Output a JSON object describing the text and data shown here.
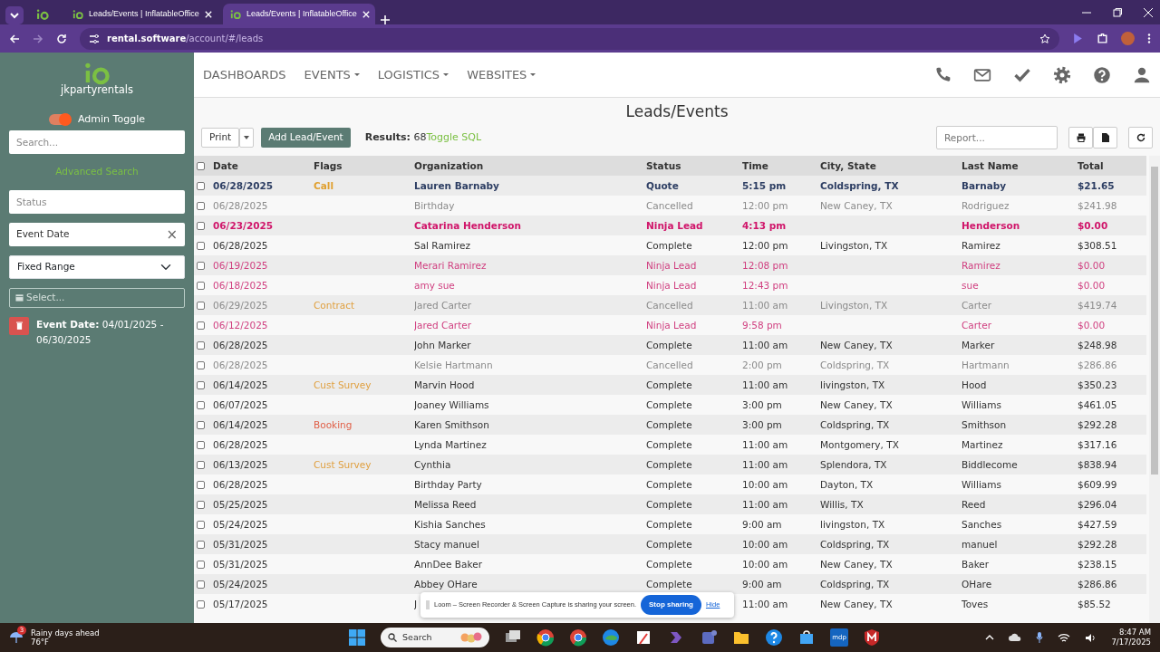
{
  "browser": {
    "tabs": [
      {
        "title": "Leads/Events | InflatableOffice",
        "selected": false
      },
      {
        "title": "Leads/Events | InflatableOffice",
        "selected": true
      }
    ],
    "url": {
      "host": "rental.software",
      "path": "/account/#/leads"
    }
  },
  "sidebar": {
    "brand": "jkpartyrentals",
    "admin_toggle": {
      "label": "Admin Toggle",
      "on": true
    },
    "search": {
      "placeholder": "Search..."
    },
    "advanced_search": "Advanced Search",
    "status": {
      "placeholder": "Status"
    },
    "event_date": {
      "value": "Event Date",
      "clear": "×"
    },
    "range": {
      "value": "Fixed Range"
    },
    "date_picker": {
      "placeholder": "Select..."
    },
    "filter": "**Event Date:** 04/01/2025 - 06/30/2025"
  },
  "nav": [
    {
      "label": "DASHBOARDS",
      "dropdown": false
    },
    {
      "label": "EVENTS",
      "dropdown": true
    },
    {
      "label": "LOGISTICS",
      "dropdown": true
    },
    {
      "label": "WEBSITES",
      "dropdown": true
    }
  ],
  "page": {
    "title": "Leads/Events",
    "print": "Print",
    "add": "Add Lead/Event",
    "results": "**Results:** 68",
    "toggle_sql": "Toggle SQL",
    "report": {
      "placeholder": "Report..."
    }
  },
  "table": {
    "columns": [
      "Date",
      "Flags",
      "Organization",
      "Status",
      "Time",
      "City, State",
      "Last Name",
      "Total"
    ],
    "all_checked": false,
    "rows": [
      {
        "kind": "quote",
        "checked": false,
        "date": "06/28/2025",
        "flag": {
          "text": "Call",
          "color": "#e0a030"
        },
        "org": "Lauren Barnaby",
        "status": "Quote",
        "time": "5:15 pm",
        "city": "Coldspring, TX",
        "last": "Barnaby",
        "total": "$21.65"
      },
      {
        "kind": "cancelled",
        "checked": false,
        "date": "06/28/2025",
        "org": "Birthday",
        "status": "Cancelled",
        "time": "12:00 pm",
        "city": "New Caney, TX",
        "last": "Rodriguez",
        "total": "$241.98"
      },
      {
        "kind": "ninja_new",
        "checked": false,
        "date": "06/23/2025",
        "org": "Catarina Henderson",
        "status": "Ninja Lead",
        "time": "4:13 pm",
        "last": "Henderson",
        "total": "$0.00"
      },
      {
        "kind": "complete",
        "checked": false,
        "date": "06/28/2025",
        "org": "Sal Ramirez",
        "status": "Complete",
        "time": "12:00 pm",
        "city": "Livingston, TX",
        "last": "Ramirez",
        "total": "$308.51"
      },
      {
        "kind": "ninja",
        "checked": false,
        "date": "06/19/2025",
        "org": "Merari Ramirez",
        "status": "Ninja Lead",
        "time": "12:08 pm",
        "last": "Ramirez",
        "total": "$0.00"
      },
      {
        "kind": "ninja",
        "checked": false,
        "date": "06/18/2025",
        "org": "amy sue",
        "status": "Ninja Lead",
        "time": "12:43 pm",
        "last": "sue",
        "total": "$0.00"
      },
      {
        "kind": "cancelled",
        "checked": false,
        "date": "06/29/2025",
        "flag": {
          "text": "Contract",
          "color": "#e0a040"
        },
        "org": "Jared Carter",
        "status": "Cancelled",
        "time": "11:00 am",
        "city": "Livingston, TX",
        "last": "Carter",
        "total": "$419.74"
      },
      {
        "kind": "ninja",
        "checked": false,
        "date": "06/12/2025",
        "org": "Jared Carter",
        "status": "Ninja Lead",
        "time": "9:58 pm",
        "last": "Carter",
        "total": "$0.00"
      },
      {
        "kind": "complete",
        "checked": false,
        "date": "06/28/2025",
        "org": "John Marker",
        "status": "Complete",
        "time": "11:00 am",
        "city": "New Caney, TX",
        "last": "Marker",
        "total": "$248.98"
      },
      {
        "kind": "cancelled",
        "checked": false,
        "date": "06/28/2025",
        "org": "Kelsie Hartmann",
        "status": "Cancelled",
        "time": "2:00 pm",
        "city": "Coldspring, TX",
        "last": "Hartmann",
        "total": "$286.86"
      },
      {
        "kind": "complete",
        "checked": false,
        "date": "06/14/2025",
        "flag": {
          "text": "Cust Survey",
          "color": "#e0a040"
        },
        "org": "Marvin Hood",
        "status": "Complete",
        "time": "11:00 am",
        "city": "livingston, TX",
        "last": "Hood",
        "total": "$350.23"
      },
      {
        "kind": "complete",
        "checked": false,
        "date": "06/07/2025",
        "org": "Joaney Williams",
        "status": "Complete",
        "time": "3:00 pm",
        "city": "New Caney, TX",
        "last": "Williams",
        "total": "$461.05"
      },
      {
        "kind": "complete",
        "checked": false,
        "date": "06/14/2025",
        "flag": {
          "text": "Booking",
          "color": "#e06048"
        },
        "org": "Karen Smithson",
        "status": "Complete",
        "time": "3:00 pm",
        "city": "Coldspring, TX",
        "last": "Smithson",
        "total": "$292.28"
      },
      {
        "kind": "complete",
        "checked": false,
        "date": "06/28/2025",
        "org": "Lynda Martinez",
        "status": "Complete",
        "time": "11:00 am",
        "city": "Montgomery, TX",
        "last": "Martinez",
        "total": "$317.16"
      },
      {
        "kind": "complete",
        "checked": false,
        "date": "06/13/2025",
        "flag": {
          "text": "Cust Survey",
          "color": "#e0a040"
        },
        "org": "Cynthia",
        "status": "Complete",
        "time": "11:00 am",
        "city": "Splendora, TX",
        "last": "Biddlecome",
        "total": "$838.94"
      },
      {
        "kind": "complete",
        "checked": false,
        "date": "06/28/2025",
        "org": "Birthday Party",
        "status": "Complete",
        "time": "10:00 am",
        "city": "Dayton, TX",
        "last": "Williams",
        "total": "$609.99"
      },
      {
        "kind": "complete",
        "checked": false,
        "date": "05/25/2025",
        "org": "Melissa Reed",
        "status": "Complete",
        "time": "11:00 am",
        "city": "Willis, TX",
        "last": "Reed",
        "total": "$296.04"
      },
      {
        "kind": "complete",
        "checked": false,
        "date": "05/24/2025",
        "org": "Kishia Sanches",
        "status": "Complete",
        "time": "9:00 am",
        "city": "livingston, TX",
        "last": "Sanches",
        "total": "$427.59"
      },
      {
        "kind": "complete",
        "checked": false,
        "date": "05/31/2025",
        "org": "Stacy manuel",
        "status": "Complete",
        "time": "10:00 am",
        "city": "Coldspring, TX",
        "last": "manuel",
        "total": "$292.28"
      },
      {
        "kind": "complete",
        "checked": false,
        "date": "05/31/2025",
        "org": "AnnDee Baker",
        "status": "Complete",
        "time": "10:00 am",
        "city": "New Caney, TX",
        "last": "Baker",
        "total": "$238.15"
      },
      {
        "kind": "complete",
        "checked": false,
        "date": "05/24/2025",
        "org": "Abbey OHare",
        "status": "Complete",
        "time": "9:00 am",
        "city": "Coldspring, TX",
        "last": "OHare",
        "total": "$286.86"
      },
      {
        "kind": "complete",
        "checked": false,
        "date": "05/17/2025",
        "org": "J",
        "time": "11:00 am",
        "city": "New Caney, TX",
        "last": "Toves",
        "total": "$85.52"
      }
    ]
  },
  "share_bar": {
    "message": "Loom – Screen Recorder & Screen Capture is sharing your screen.",
    "stop": "Stop sharing",
    "hide": "Hide"
  },
  "taskbar": {
    "weather": {
      "title": "Rainy days ahead",
      "temp": "76°F",
      "badge": "3"
    },
    "search": {
      "placeholder": "Search"
    },
    "app_label": "mdp",
    "time": "8:47 AM",
    "date": "7/17/2025"
  }
}
